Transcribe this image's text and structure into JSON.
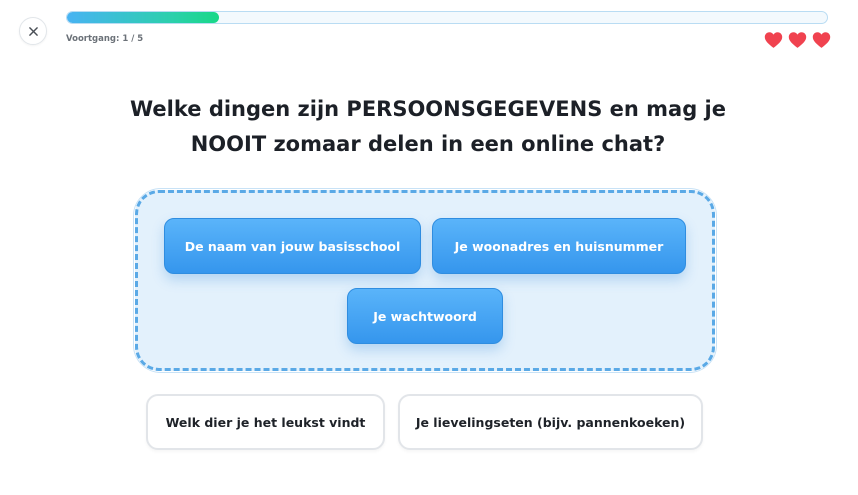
{
  "header": {
    "close_icon": "close-icon",
    "progress": {
      "label": "Voortgang: 1 / 5",
      "current": 1,
      "total": 5,
      "fraction": 0.2,
      "color_start": "#48b3f3",
      "color_end": "#18d887"
    },
    "lives": {
      "count": 3,
      "icon": "heart-icon",
      "color": "#f0424f"
    }
  },
  "question": {
    "line1": "Welke dingen zijn PERSOONSGEGEVENS en mag je",
    "line2": "NOOIT zomaar delen in een online chat?"
  },
  "answer_zone": {
    "border_color": "#5aa9e6",
    "background": "#e3f1fc",
    "selected": [
      "De naam van jouw basisschool",
      "Je woonadres en huisnummer",
      "Je wachtwoord"
    ]
  },
  "options": [
    "Welk dier je het leukst vindt",
    "Je lievelingseten (bijv. pannenkoeken)"
  ]
}
